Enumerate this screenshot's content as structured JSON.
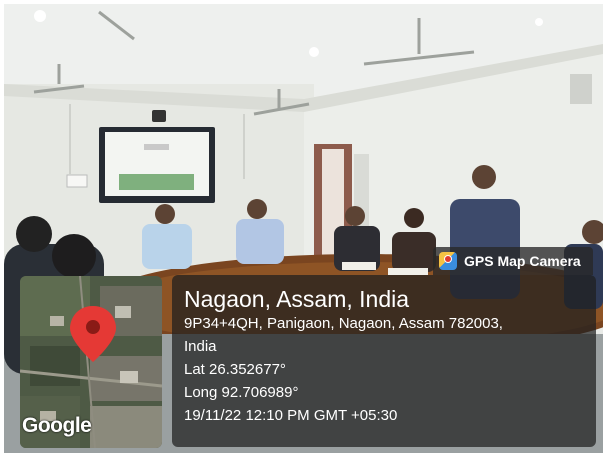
{
  "overlay": {
    "badge_label": "GPS Map Camera",
    "badge_icon": "gps-map-camera-app-icon",
    "place_title": "Nagaon, Assam, India",
    "address_line_1": "9P34+4QH, Panigaon, Nagaon, Assam 782003,",
    "address_line_2": "India",
    "latitude": "Lat 26.352677°",
    "longitude": "Long 92.706989°",
    "datetime": "19/11/22 12:10 PM GMT +05:30"
  },
  "map": {
    "logo_text": "Google",
    "marker_icon": "location-pin-icon",
    "marker_color": "#e53935"
  },
  "colors": {
    "panel_background": "rgba(30,30,30,0.72)",
    "text": "#ffffff"
  }
}
